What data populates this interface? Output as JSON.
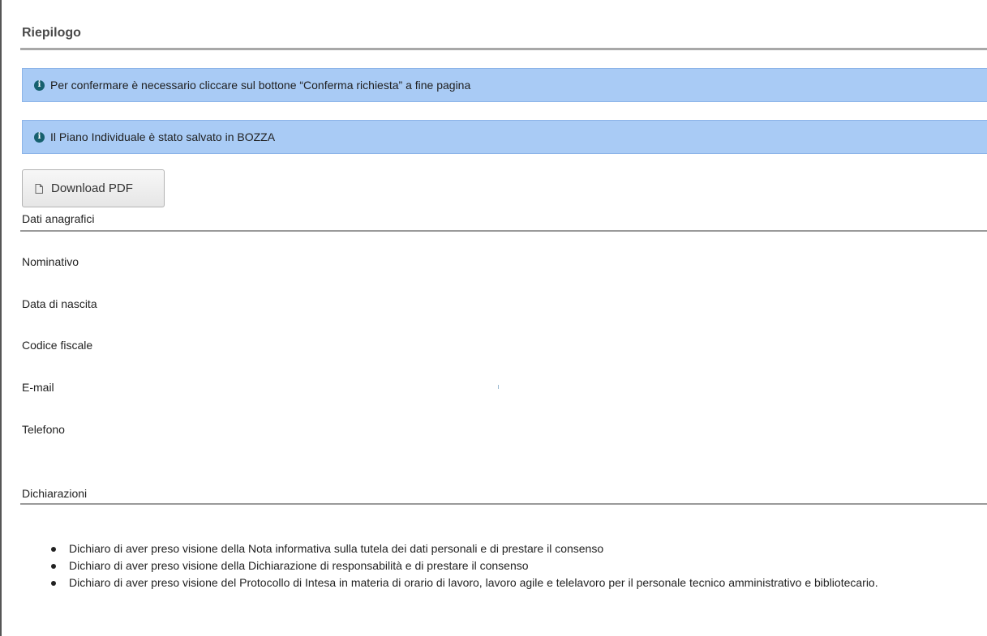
{
  "panel": {
    "title": "Riepilogo"
  },
  "alerts": [
    {
      "icon": "info-icon",
      "text": "Per confermare è necessario cliccare sul bottone “Conferma richiesta” a fine pagina"
    },
    {
      "icon": "info-icon",
      "text": "Il Piano Individuale è stato salvato in BOZZA"
    }
  ],
  "download_button": {
    "icon": "file-icon",
    "label": "Download PDF"
  },
  "personal_data": {
    "section_title": "Dati anagrafici",
    "fields": [
      {
        "label": "Nominativo"
      },
      {
        "label": "Data di nascita"
      },
      {
        "label": "Codice fiscale"
      },
      {
        "label": "E-mail"
      },
      {
        "label": "Telefono"
      }
    ]
  },
  "declarations": {
    "section_title": "Dichiarazioni",
    "items": [
      "Dichiaro di aver preso visione della Nota informativa sulla tutela dei dati personali e di prestare il consenso",
      "Dichiaro di aver preso visione della Dichiarazione di responsabilità e di prestare il consenso",
      "Dichiaro di aver preso visione del Protocollo di Intesa in materia di orario di lavoro, lavoro agile e telelavoro per il personale tecnico amministrativo e bibliotecario."
    ]
  },
  "colors": {
    "alert_background": "#a9cbf5",
    "info_icon": "#16606e",
    "rule": "#a8a8a8"
  }
}
